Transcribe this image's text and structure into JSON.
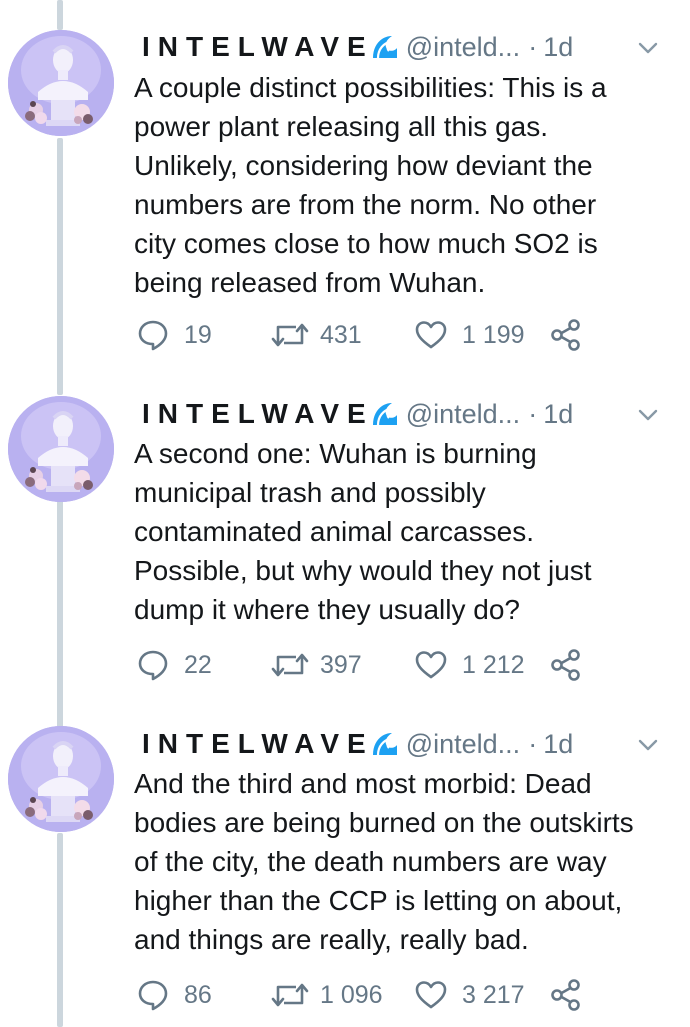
{
  "colors": {
    "text": "#14171a",
    "muted": "#657786",
    "thread_line": "#ccd6dd",
    "avatar_bg": "#b8b0ef",
    "wave": "#1da1f2"
  },
  "icons": {
    "reply": "speech-bubble-outline",
    "retweet": "retweet-arrows",
    "like": "heart-outline",
    "share": "share-nodes",
    "badge": "water-wave-emoji",
    "menu": "chevron-down"
  },
  "tweets": [
    {
      "display_name": "INTELWAVE",
      "handle": "@inteld...",
      "separator": "·",
      "time": "1d",
      "lines": [
        "A couple distinct possibilities: This is a",
        "power plant releasing all this gas.",
        "Unlikely, considering how deviant the",
        "numbers are from the norm. No other",
        "city comes close to how much SO2 is",
        "being released from Wuhan."
      ],
      "replies": "19",
      "retweets": "431",
      "likes": "1 199"
    },
    {
      "display_name": "INTELWAVE",
      "handle": "@inteld...",
      "separator": "·",
      "time": "1d",
      "lines": [
        "A second one: Wuhan is burning",
        "municipal trash and possibly",
        "contaminated animal carcasses.",
        "Possible, but why would they not just",
        "dump it where they usually do?"
      ],
      "replies": "22",
      "retweets": "397",
      "likes": "1 212"
    },
    {
      "display_name": "INTELWAVE",
      "handle": "@inteld...",
      "separator": "·",
      "time": "1d",
      "lines": [
        "And the third and most morbid: Dead",
        "bodies are being burned on the outskirts",
        "of the city, the death numbers are way",
        "higher than the CCP is letting on about,",
        "and things are really, really bad."
      ],
      "replies": "86",
      "retweets": "1 096",
      "likes": "3 217"
    }
  ]
}
